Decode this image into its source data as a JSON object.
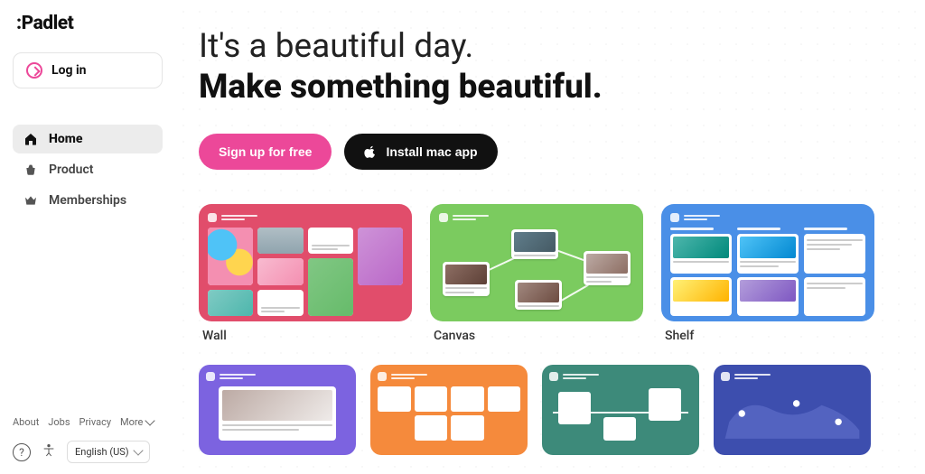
{
  "brand": {
    "name": ":Padlet"
  },
  "auth": {
    "login_label": "Log in"
  },
  "nav": {
    "items": [
      {
        "label": "Home",
        "icon": "home"
      },
      {
        "label": "Product",
        "icon": "basket"
      },
      {
        "label": "Memberships",
        "icon": "crown"
      }
    ]
  },
  "footer": {
    "links": [
      "About",
      "Jobs",
      "Privacy",
      "More"
    ],
    "language": "English (US)"
  },
  "headline": {
    "line1": "It's a beautiful day.",
    "line2": "Make something beautiful."
  },
  "cta": {
    "signup": "Sign up for free",
    "install": "Install mac app"
  },
  "templates": {
    "row1": [
      {
        "label": "Wall",
        "color": "#e14d6b"
      },
      {
        "label": "Canvas",
        "color": "#7bcb5f"
      },
      {
        "label": "Shelf",
        "color": "#4a8fe7"
      }
    ],
    "row2_colors": [
      "#7c63e0",
      "#f58a3c",
      "#3d8a7a",
      "#3d4eae"
    ]
  }
}
